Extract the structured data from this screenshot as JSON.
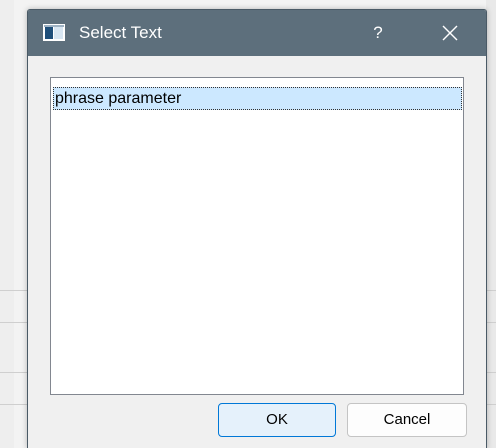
{
  "dialog": {
    "title": "Select Text",
    "help_label": "?",
    "items": [
      "phrase parameter"
    ],
    "selected_index": 0,
    "ok_label": "OK",
    "cancel_label": "Cancel"
  },
  "colors": {
    "titlebar": "#5d6f7c",
    "selection": "#cce8ff",
    "ok_border": "#0078d7"
  },
  "icons": {
    "app": "window-app-icon",
    "close": "close-icon"
  }
}
